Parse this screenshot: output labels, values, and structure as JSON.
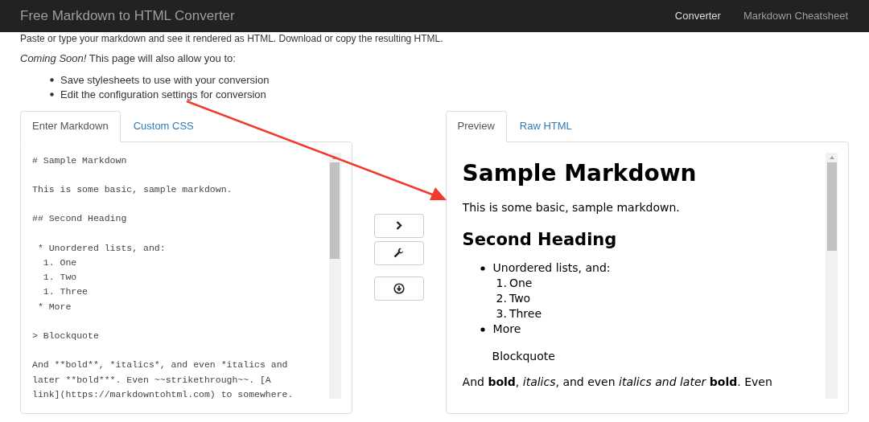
{
  "navbar": {
    "brand": "Free Markdown to HTML Converter",
    "links": [
      {
        "label": "Converter",
        "selected": true
      },
      {
        "label": "Markdown Cheatsheet",
        "selected": false
      }
    ]
  },
  "intro": {
    "line": "Paste or type your markdown and see it rendered as HTML. Download or copy the resulting HTML.",
    "coming_soon": "*Coming Soon!* This page will also allow you to:",
    "bullets": [
      "Save stylesheets to use with your conversion",
      "Edit the configuration settings for conversion"
    ]
  },
  "editor_panel": {
    "tabs": [
      {
        "label": "Enter Markdown",
        "selected": true
      },
      {
        "label": "Custom CSS",
        "selected": false
      }
    ],
    "text": "# Sample Markdown\n\nThis is some basic, sample markdown.\n\n## Second Heading\n\n * Unordered lists, and:\n  1. One\n  1. Two\n  1. Three\n * More\n\n> Blockquote\n\nAnd **bold**, *italics*, and even *italics and\nlater **bold***. Even ~~strikethrough~~. [A\nlink](https://markdowntohtml.com) to somewhere."
  },
  "actions": [
    {
      "kind": "convert"
    },
    {
      "kind": "settings"
    },
    {
      "kind": "download"
    }
  ],
  "preview_panel": {
    "tabs": [
      {
        "label": "Preview",
        "selected": true
      },
      {
        "label": "Raw HTML",
        "selected": false
      }
    ],
    "heading": "Sample Markdown",
    "paragraph": "This is some basic, sample markdown.",
    "subheading": "Second Heading",
    "list": [
      {
        "text": "Unordered lists, and:",
        "children": [
          {
            "number": "1.",
            "text": "One"
          },
          {
            "number": "2.",
            "text": "Two"
          },
          {
            "number": "3.",
            "text": "Three"
          }
        ]
      },
      {
        "text": "More"
      }
    ],
    "blockquote": "Blockquote",
    "last_line": "And **bold**, *italics*, and even *italics and later* **bold**. Even"
  },
  "annotation": {
    "kind": "arrow"
  }
}
